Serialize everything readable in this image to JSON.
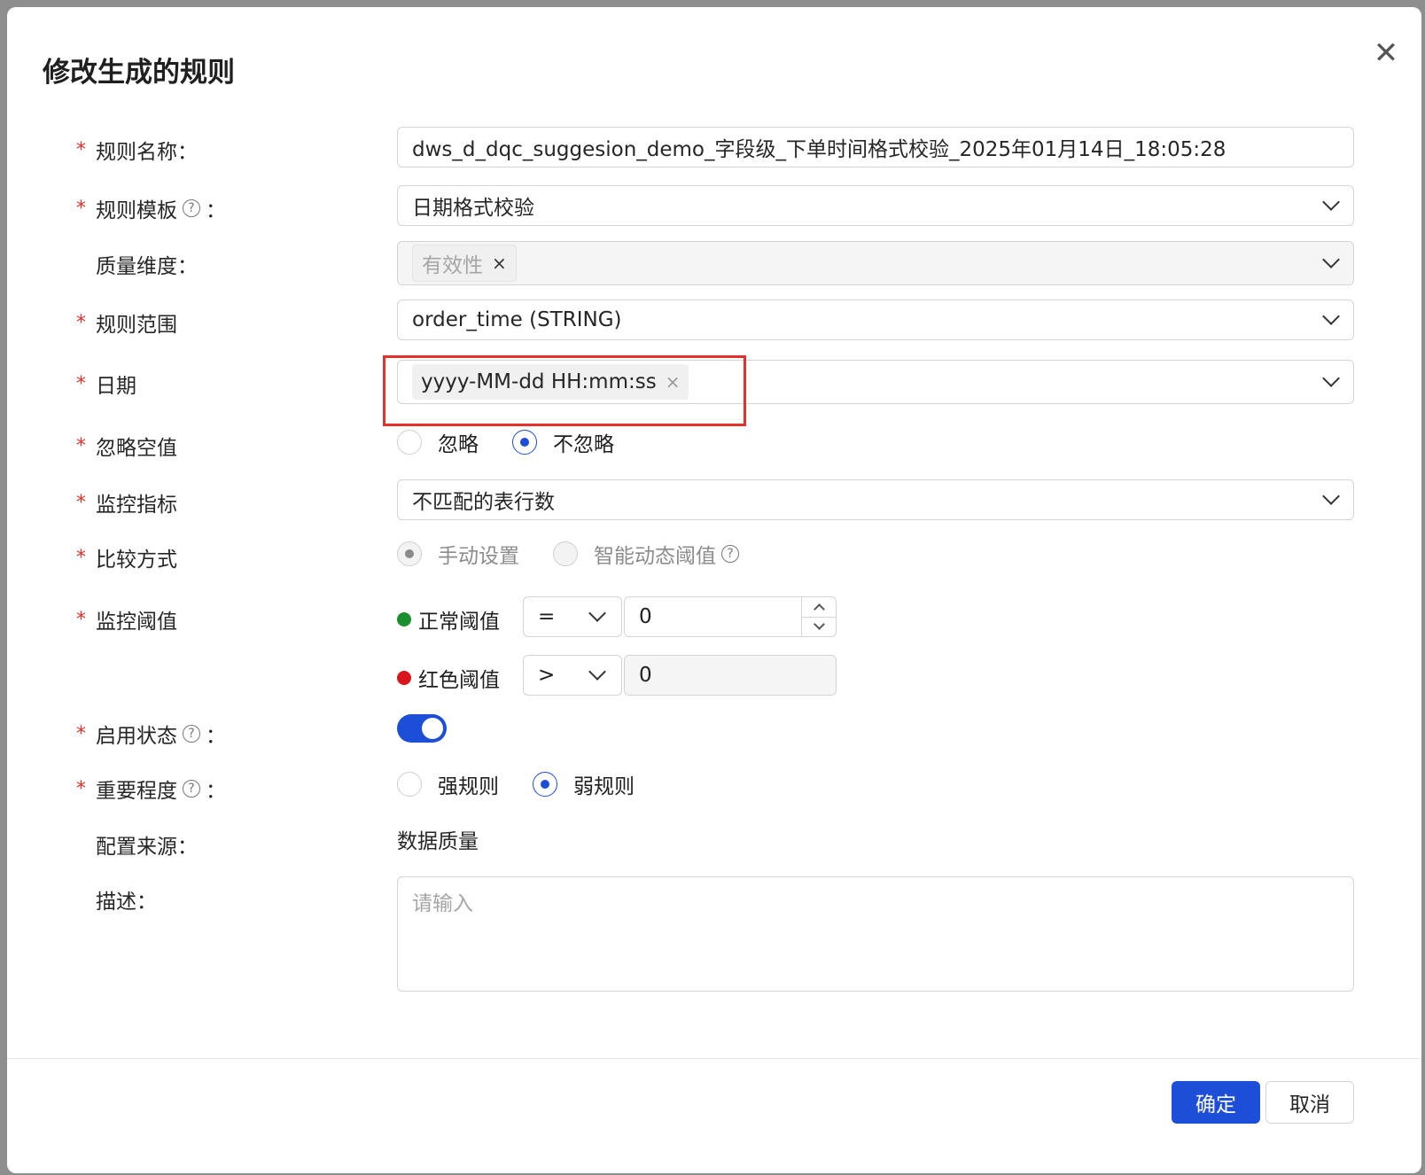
{
  "dialog": {
    "title": "修改生成的规则"
  },
  "fields": {
    "rule_name": {
      "label": "规则名称：",
      "value": "dws_d_dqc_suggesion_demo_字段级_下单时间格式校验_2025年01月14日_18:05:28"
    },
    "rule_template": {
      "label": "规则模板",
      "value": "日期格式校验"
    },
    "quality_dimension": {
      "label": "质量维度：",
      "tag": "有效性"
    },
    "rule_scope": {
      "label": "规则范围",
      "value": "order_time (STRING)"
    },
    "date": {
      "label": "日期",
      "tag": "yyyy-MM-dd HH:mm:ss"
    },
    "ignore_null": {
      "label": "忽略空值",
      "options": [
        "忽略",
        "不忽略"
      ],
      "selected": "不忽略"
    },
    "metric": {
      "label": "监控指标",
      "value": "不匹配的表行数"
    },
    "compare_method": {
      "label": "比较方式",
      "options": [
        "手动设置",
        "智能动态阈值"
      ],
      "selected": "手动设置"
    },
    "threshold": {
      "label": "监控阈值",
      "normal": {
        "label": "正常阈值",
        "operator": "=",
        "value": "0",
        "color": "#1a8f2e"
      },
      "red": {
        "label": "红色阈值",
        "operator": ">",
        "value": "0",
        "color": "#d9141a"
      }
    },
    "enabled": {
      "label": "启用状态",
      "on": true
    },
    "importance": {
      "label": "重要程度",
      "options": [
        "强规则",
        "弱规则"
      ],
      "selected": "弱规则"
    },
    "config_source": {
      "label": "配置来源：",
      "value": "数据质量"
    },
    "description": {
      "label": "描述：",
      "placeholder": "请输入"
    }
  },
  "common": {
    "required_mark": "*",
    "help_mark": "?",
    "colon": "：",
    "close_mark": "✕",
    "remove_mark": "×"
  },
  "footer": {
    "ok_label": "确定",
    "cancel_label": "取消"
  },
  "colors": {
    "primary": "#1d4ed8",
    "required": "#e8302a",
    "highlight": "#e8302a"
  }
}
